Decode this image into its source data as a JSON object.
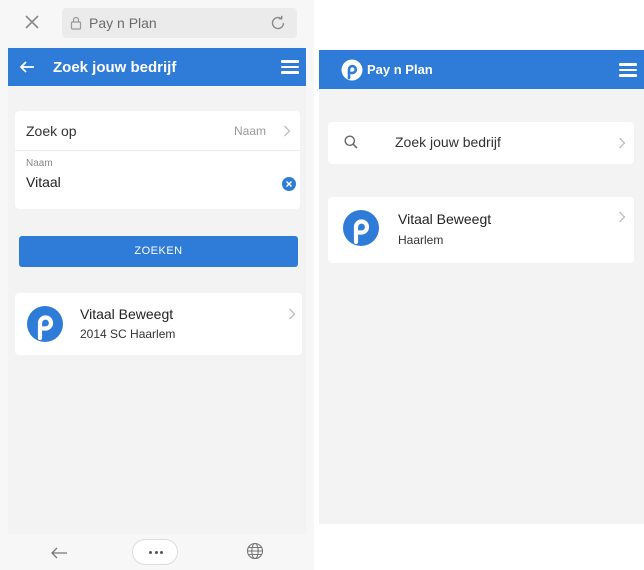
{
  "left": {
    "browser": {
      "url_text": "Pay n Plan"
    },
    "header": {
      "title": "Zoek jouw bedrijf"
    },
    "search": {
      "zoek_op_label": "Zoek op",
      "zoek_op_value": "Naam",
      "naam_label": "Naam",
      "naam_value": "Vitaal"
    },
    "button": {
      "label": "ZOEKEN"
    },
    "result": {
      "name": "Vitaal Beweegt",
      "address": "2014 SC Haarlem"
    }
  },
  "right": {
    "header": {
      "brand": "Pay n Plan"
    },
    "search_row": {
      "label": "Zoek jouw bedrijf"
    },
    "result": {
      "name": "Vitaal Beweegt",
      "city": "Haarlem"
    }
  },
  "colors": {
    "accent": "#2f7bd8",
    "background": "#f3f3f3",
    "card": "#ffffff"
  },
  "icons": [
    "close-icon",
    "lock-icon",
    "reload-icon",
    "back-arrow-icon",
    "menu-icon",
    "chevron-right-icon",
    "clear-icon",
    "logo-icon",
    "search-icon",
    "nav-back-icon",
    "more-icon",
    "globe-icon"
  ]
}
